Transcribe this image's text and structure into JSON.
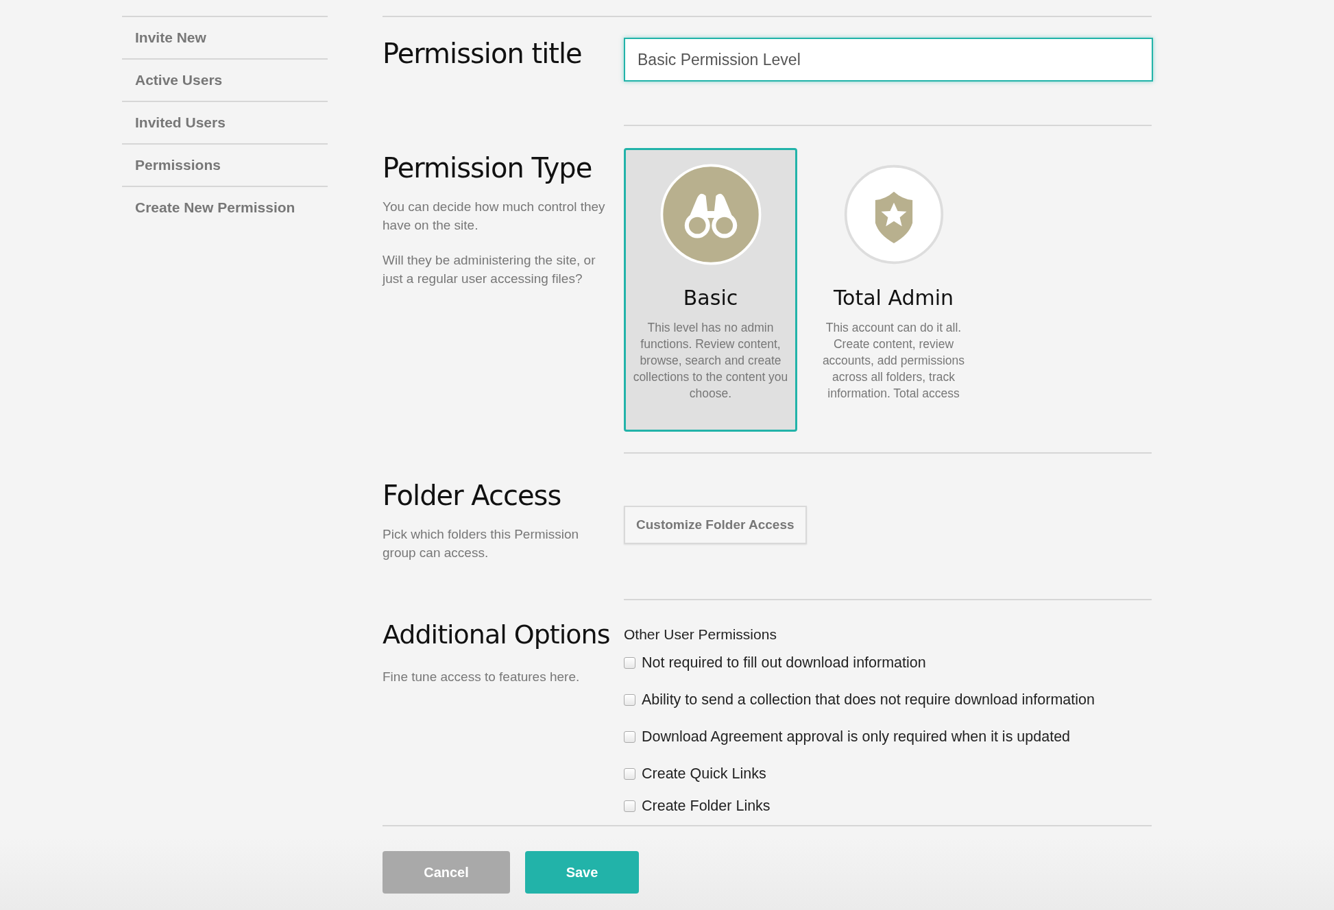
{
  "sidebar": {
    "items": [
      {
        "label": "Invite New"
      },
      {
        "label": "Active Users"
      },
      {
        "label": "Invited Users"
      },
      {
        "label": "Permissions"
      },
      {
        "label": "Create New Permission"
      }
    ]
  },
  "title_section": {
    "heading": "Permission title",
    "value": "Basic Permission Level"
  },
  "type_section": {
    "heading": "Permission Type",
    "paragraphs": [
      "You can decide how much control they have on the site.",
      "Will they be administering the site, or just a regular user accessing files?"
    ],
    "options": [
      {
        "kind": "binoculars",
        "title": "Basic",
        "description": "This level has no admin functions. Review content, browse, search and create collections to the content you choose.",
        "selected": true
      },
      {
        "kind": "shield",
        "title": "Total Admin",
        "description": "This account can do it all. Create content, review accounts, add permissions across all folders, track information. Total access",
        "selected": false
      }
    ]
  },
  "folder_section": {
    "heading": "Folder Access",
    "description": "Pick which folders this Permission group can access.",
    "button": "Customize Folder Access"
  },
  "options_section": {
    "heading": "Additional Options",
    "description": "Fine tune access to features here.",
    "group_label": "Other User Permissions",
    "options": [
      {
        "label": "Not required to fill out download information",
        "checked": false
      },
      {
        "label": "Ability to send a collection that does not require download information",
        "checked": false
      },
      {
        "label": "Download Agreement approval is only required when it is updated",
        "checked": false
      },
      {
        "label": "Create Quick Links",
        "checked": false
      },
      {
        "label": "Create Folder Links",
        "checked": false
      }
    ]
  },
  "buttons": {
    "cancel": "Cancel",
    "save": "Save"
  }
}
